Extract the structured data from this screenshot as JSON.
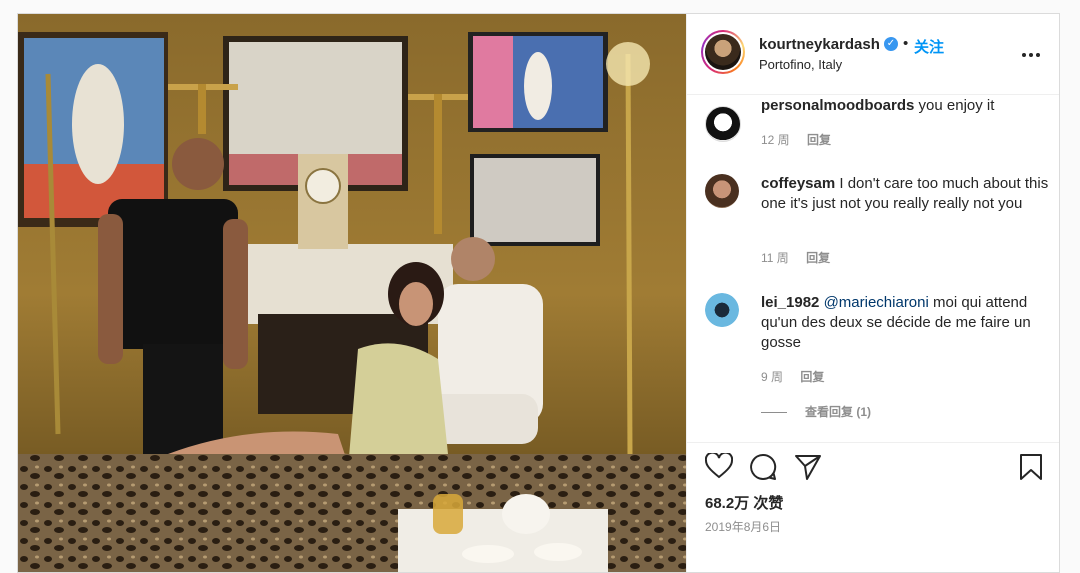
{
  "post": {
    "username": "kourtneykardash",
    "verified_mark": "✓",
    "dot": "•",
    "follow_label": "关注",
    "location": "Portofino, Italy",
    "more_icon": "more-horizontal-icon"
  },
  "comments": [
    {
      "username": "personalmoodboards",
      "text": "you enjoy it",
      "age": "12 周",
      "reply_label": "回复"
    },
    {
      "username": "coffeysam",
      "text": "I don't care too much about this one it's just not you really really not you",
      "age": "11 周",
      "reply_label": "回复"
    },
    {
      "username": "lei_1982",
      "mention": "@mariechiaroni",
      "text": " moi qui attend qu'un des deux se décide de me faire un gosse",
      "age": "9 周",
      "reply_label": "回复",
      "view_replies": "查看回复 (1)"
    }
  ],
  "actions": {
    "likes": "68.2万 次赞",
    "date": "2019年8月6日",
    "icons": [
      "heart-icon",
      "comment-icon",
      "share-icon",
      "bookmark-icon"
    ]
  },
  "colors": {
    "link": "#0095f6",
    "verified": "#3897f0",
    "muted": "#8e8e8e"
  }
}
